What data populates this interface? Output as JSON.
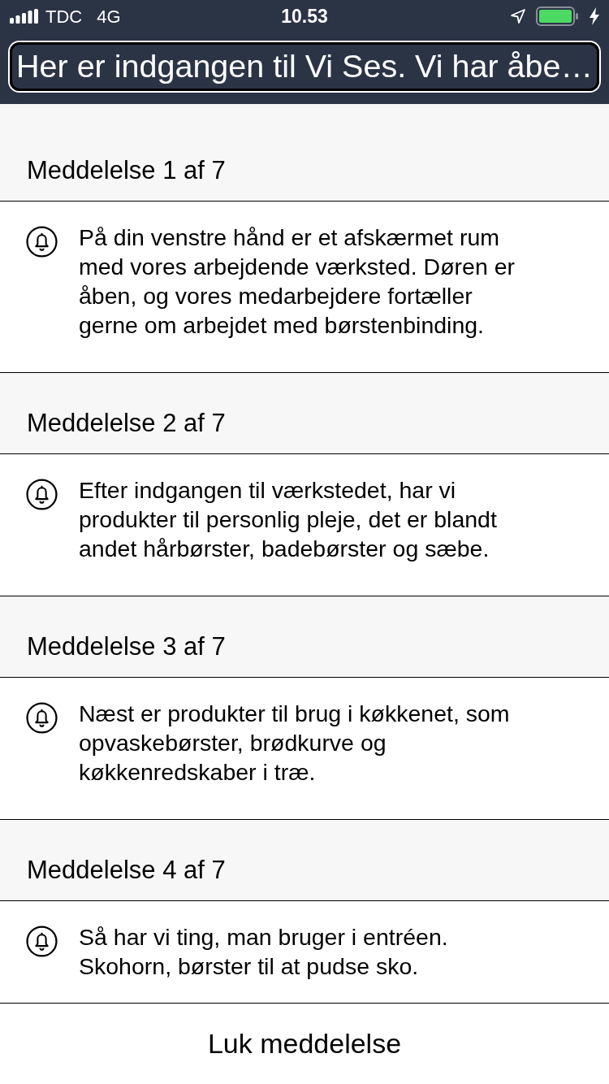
{
  "status_bar": {
    "carrier": "TDC",
    "network": "4G",
    "time": "10.53"
  },
  "title": "Her er indgangen til Vi Ses. Vi har åbe…",
  "messages": [
    {
      "heading": "Meddelelse 1 af 7",
      "text": "På din venstre hånd er et afskærmet rum med vores arbejdende værksted. Døren er åben, og vores medarbejdere fortæller gerne om arbejdet med børstenbinding."
    },
    {
      "heading": "Meddelelse 2 af 7",
      "text": "Efter indgangen til værkstedet, har vi produkter til personlig pleje, det er blandt andet hårbørster, badebørster og sæbe."
    },
    {
      "heading": "Meddelelse 3 af 7",
      "text": "Næst er produkter til brug i køkkenet, som opvaskebørster, brødkurve og køkkenredskaber i træ."
    },
    {
      "heading": "Meddelelse 4 af 7",
      "text": "Så har vi ting, man bruger i entréen. Skohorn, børster til at pudse sko."
    }
  ],
  "close_button": "Luk meddelelse"
}
